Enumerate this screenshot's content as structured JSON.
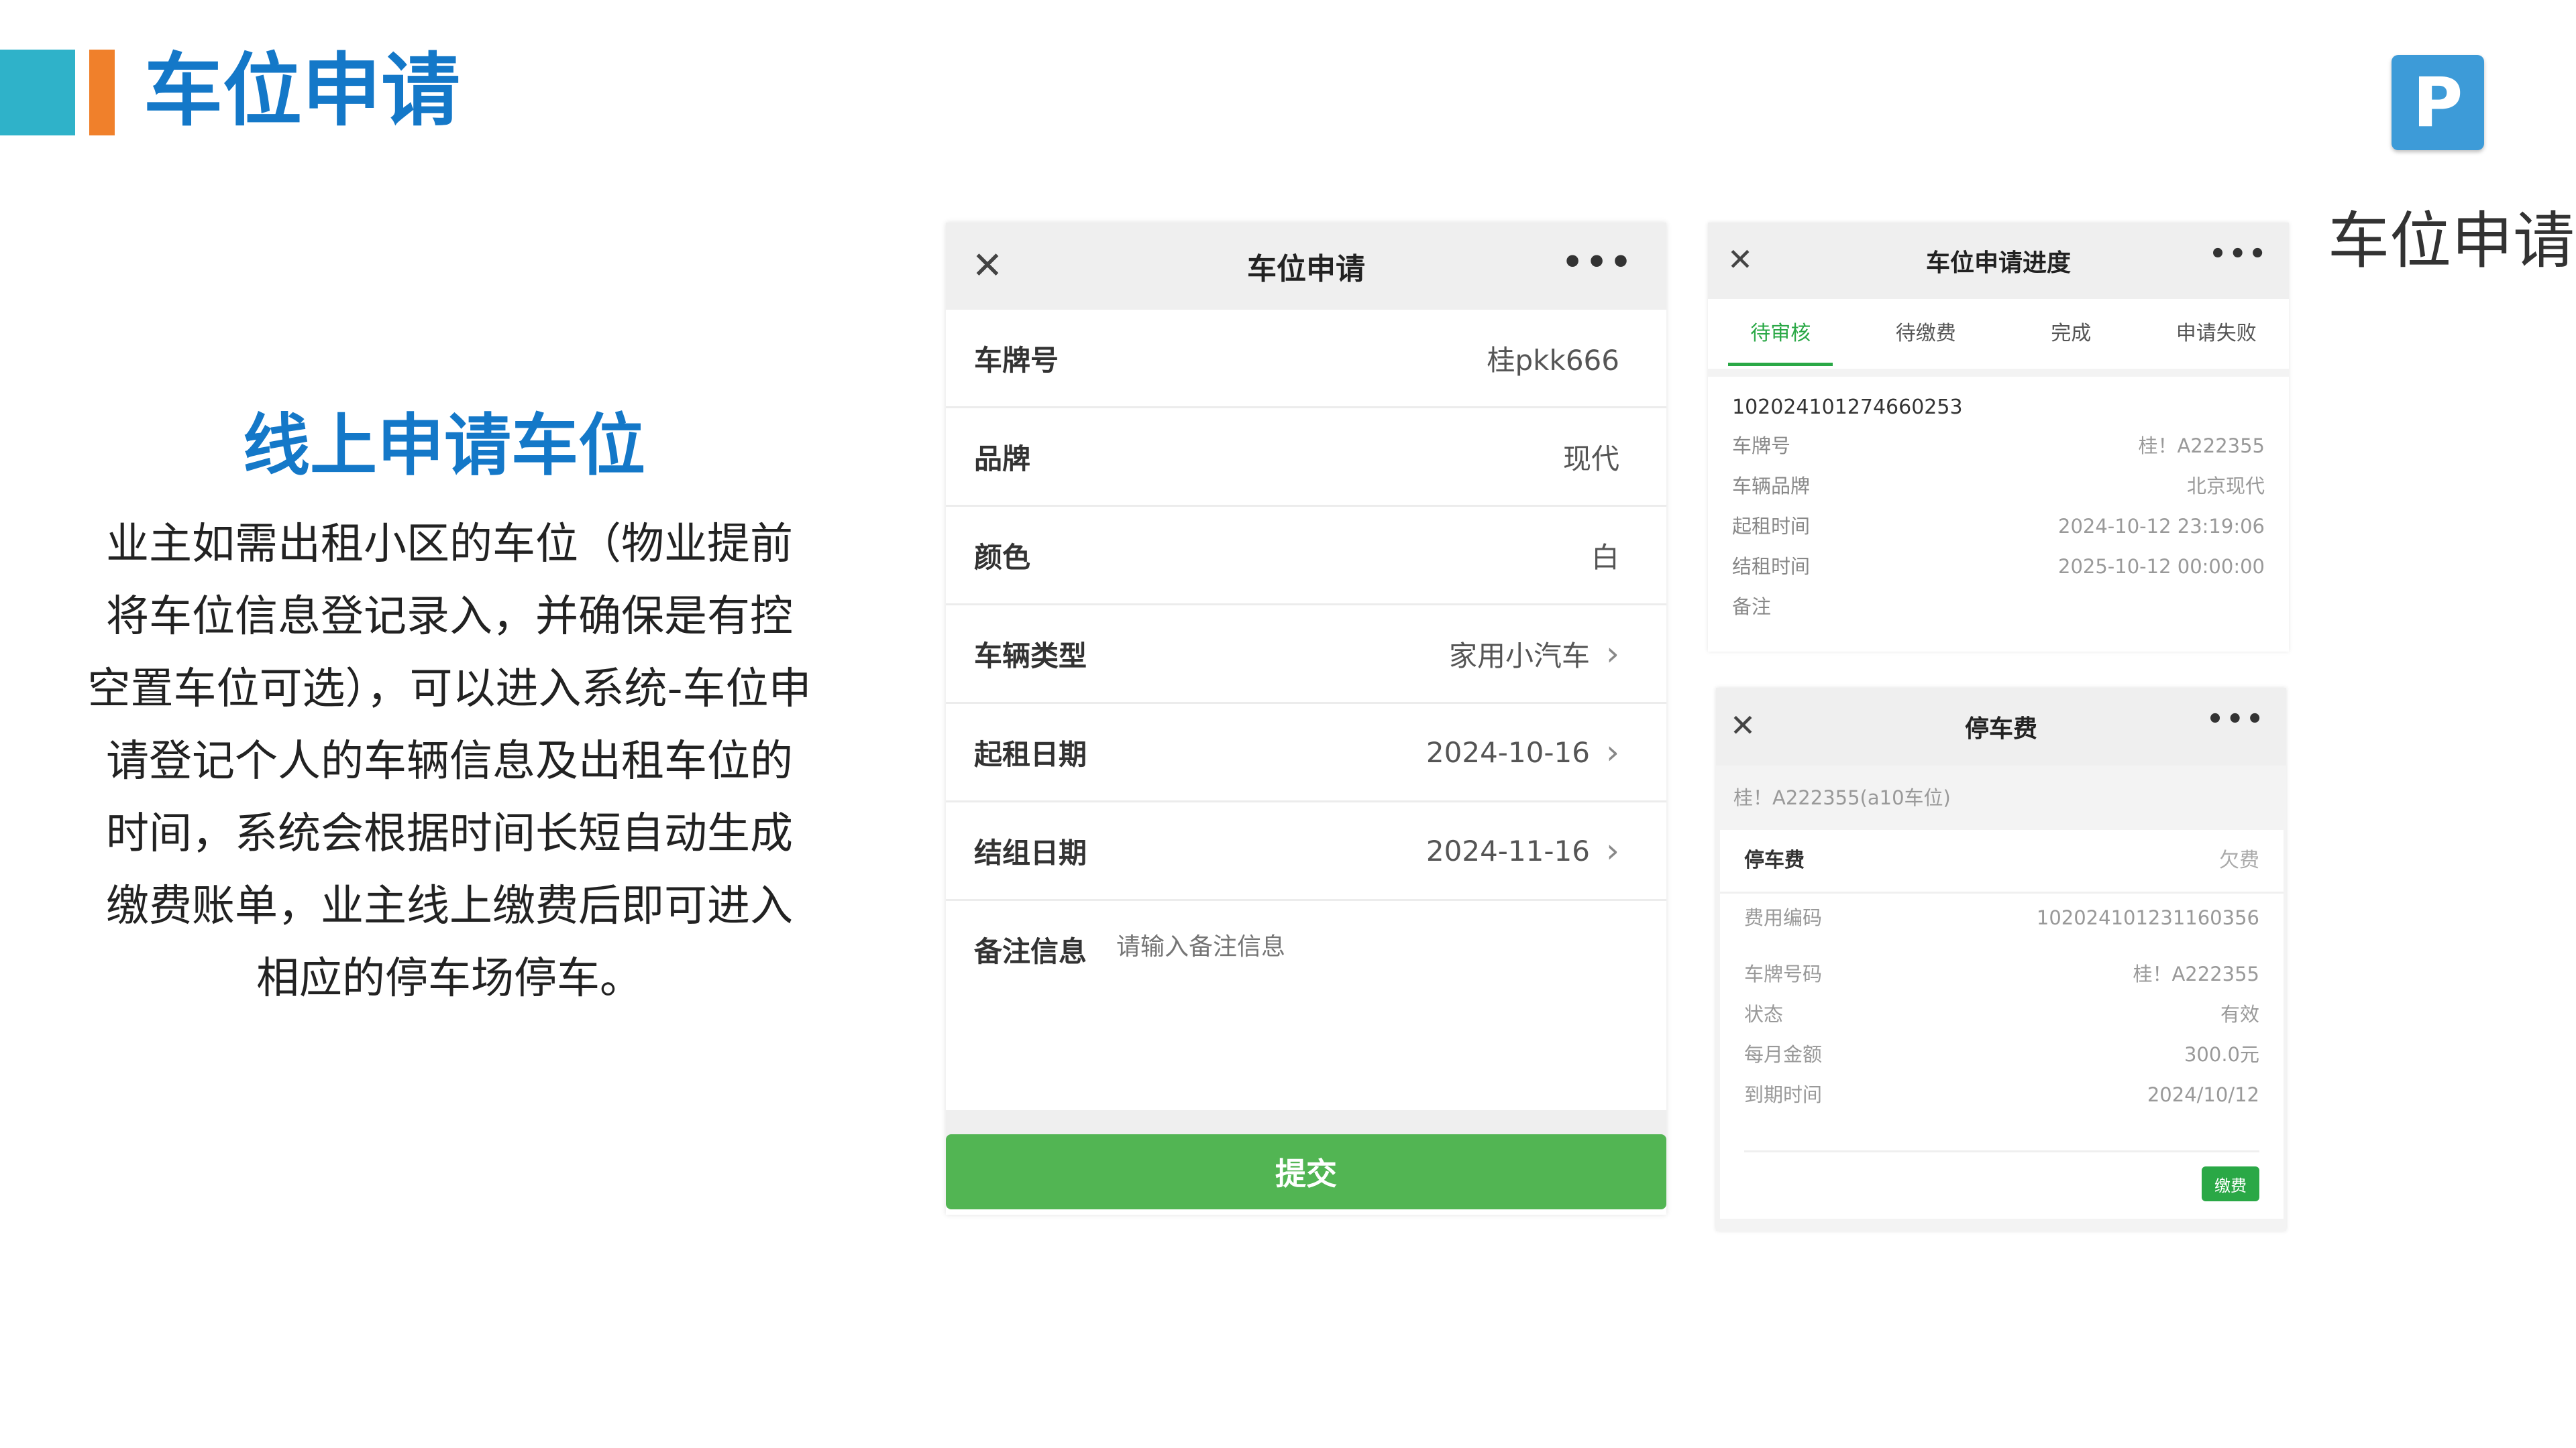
{
  "header": {
    "title": "车位申请",
    "logo_letter": "P",
    "side_label": "车位申请"
  },
  "intro": {
    "heading": "线上申请车位",
    "text": "业主如需出租小区的车位（物业提前将车位信息登记录入，并确保是有控空置车位可选），可以进入系统-车位申请登记个人的车辆信息及出租车位的时间，系统会根据时间长短自动生成缴费账单，业主线上缴费后即可进入相应的停车场停车。"
  },
  "form": {
    "title": "车位申请",
    "rows": [
      {
        "label": "车牌号",
        "value": "桂pkk666"
      },
      {
        "label": "品牌",
        "value": "现代"
      },
      {
        "label": "颜色",
        "value": "白"
      },
      {
        "label": "车辆类型",
        "value": "家用小汽车"
      },
      {
        "label": "起租日期",
        "value": "2024-10-16"
      },
      {
        "label": "结组日期",
        "value": "2024-11-16"
      }
    ],
    "remark_label": "备注信息",
    "remark_placeholder": "请输入备注信息",
    "submit_label": "提交"
  },
  "progress": {
    "title": "车位申请进度",
    "tabs": [
      "待审核",
      "待缴费",
      "完成",
      "申请失败"
    ],
    "active_tab": "待审核",
    "order_no": "102024101274660253",
    "fields": [
      {
        "key": "车牌号",
        "value": "桂！A222355"
      },
      {
        "key": "车辆品牌",
        "value": "北京现代"
      },
      {
        "key": "起租时间",
        "value": "2024-10-12 23:19:06"
      },
      {
        "key": "结租时间",
        "value": "2025-10-12 00:00:00"
      },
      {
        "key": "备注",
        "value": ""
      }
    ]
  },
  "fee": {
    "title": "停车费",
    "plate_line": "桂！A222355(a10车位)",
    "card_title": "停车费",
    "card_status": "欠费",
    "fields": [
      {
        "key": "费用编码",
        "value": "102024101231160356"
      },
      {
        "key": "车牌号码",
        "value": "桂！A222355"
      },
      {
        "key": "状态",
        "value": "有效"
      },
      {
        "key": "每月金额",
        "value": "300.0元"
      },
      {
        "key": "到期时间",
        "value": "2024/10/12"
      }
    ],
    "pay_label": "缴费"
  },
  "icons": {
    "close": "close-icon",
    "more": "more-icon",
    "chevron": "chevron-right-icon",
    "logo": "parking-icon"
  },
  "colors": {
    "title_blue": "#1478c8",
    "accent_cyan": "#2fb2c9",
    "accent_orange": "#f0802b",
    "submit_green": "#52b553",
    "tab_green": "#2aa846"
  }
}
